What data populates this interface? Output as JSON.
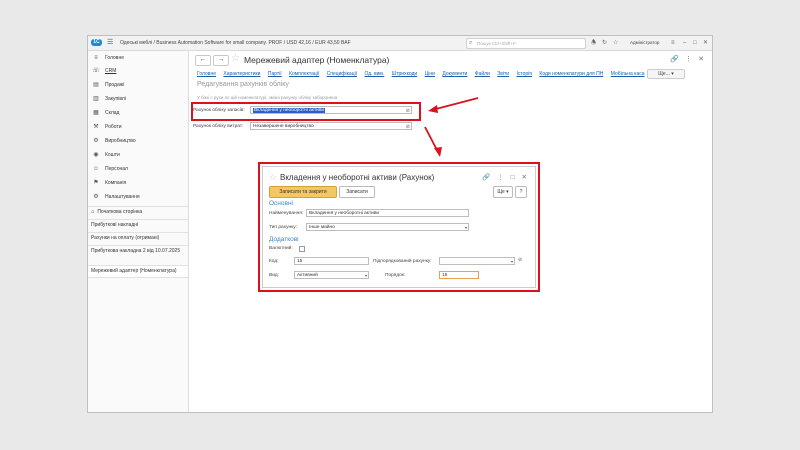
{
  "app": {
    "logo": "1C",
    "title": "Одеські меблі / Business Automation Software for small company. PROF / USD 42,16 / EUR 43,50 BAF",
    "search_placeholder": "Пошук Ctrl+Shift+F",
    "user": "Адміністратор"
  },
  "sidebar": {
    "items": [
      {
        "label": "Головне",
        "icon": "menu-icon"
      },
      {
        "label": "CRM",
        "icon": "crm-icon"
      },
      {
        "label": "Продажі",
        "icon": "sales-icon"
      },
      {
        "label": "Закупівлі",
        "icon": "purchases-icon"
      },
      {
        "label": "Склад",
        "icon": "warehouse-icon"
      },
      {
        "label": "Роботи",
        "icon": "works-icon"
      },
      {
        "label": "Виробництво",
        "icon": "production-icon"
      },
      {
        "label": "Кошти",
        "icon": "money-icon"
      },
      {
        "label": "Персонал",
        "icon": "personnel-icon"
      },
      {
        "label": "Компанія",
        "icon": "company-icon"
      },
      {
        "label": "Налаштування",
        "icon": "settings-icon"
      }
    ],
    "open_items": [
      {
        "label": "Початкова сторінка"
      },
      {
        "label": "Прибуткові накладні"
      },
      {
        "label": "Рахунки на оплату (отримані)"
      },
      {
        "label": "Прибуткова накладна 2 від 10.07.2025"
      },
      {
        "label": "Мережевий адаптер (Номенклатура)"
      }
    ]
  },
  "page": {
    "title": "Мережевий адаптер (Номенклатура)",
    "links": [
      "Головне",
      "Характеристики",
      "Партії",
      "Комплектації",
      "Специфікації",
      "Од. вим.",
      "Штрихкоди",
      "Ціни",
      "Документи",
      "Файли",
      "Звіти",
      "Історія",
      "Коди номенклатури для ПН",
      "Мобільна каса"
    ],
    "more_label": "Ще...",
    "section_title": "Редагування рахунків обліку",
    "hint": "У базі є рухи по цій номенклатурі, зміна рахунку обліку заборонена",
    "fields": {
      "inventory_label": "Рахунок обліку запасів:",
      "inventory_value": "Вкладення у необоротні активи",
      "costs_label": "Рахунок обліку витрат:",
      "costs_value": "Незавершене виробництво"
    }
  },
  "dialog": {
    "title": "Вкладення у необоротні активи (Рахунок)",
    "save_close": "Записати та закрити",
    "save": "Записати",
    "more": "Ще",
    "help": "?",
    "main_section": "Основні",
    "name_label": "Найменування:",
    "name_value": "Вкладення у необоротні активи",
    "type_label": "Тип рахунку:",
    "type_value": "Інше майно",
    "extra_section": "Додаткові",
    "currency_label": "Валютний:",
    "code_label": "Код:",
    "code_value": "15",
    "parent_label": "Підпорядкований рахунку:",
    "parent_value": "",
    "kind_label": "Вид:",
    "kind_value": "Активний",
    "order_label": "Порядок:",
    "order_value": "15"
  },
  "colors": {
    "annotation_red": "#d9121c",
    "selection_blue": "#2d5fc4",
    "primary_button": "#f6c760",
    "section_blue": "#3c86c9"
  }
}
